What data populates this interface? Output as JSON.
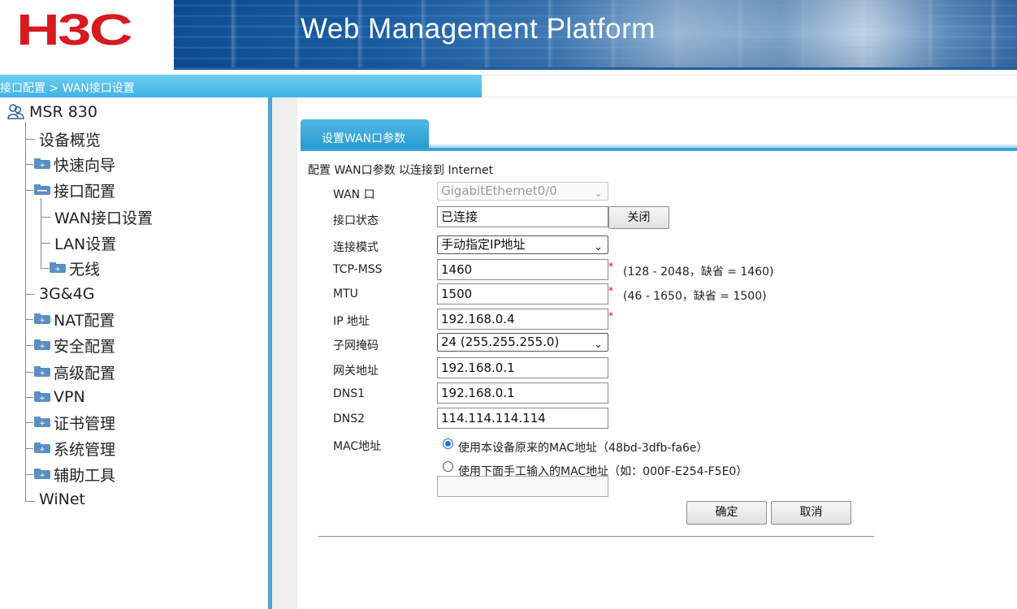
{
  "header": {
    "logo_text": "H3C",
    "platform_title": "Web Management Platform"
  },
  "breadcrumb": "接口配置 > WAN接口设置",
  "sidebar": {
    "root": "MSR 830",
    "items": [
      {
        "label": "设备概览"
      },
      {
        "label": "快速向导"
      },
      {
        "label": "接口配置"
      },
      {
        "label": "WAN接口设置"
      },
      {
        "label": "LAN设置"
      },
      {
        "label": "无线"
      },
      {
        "label": "3G&4G"
      },
      {
        "label": "NAT配置"
      },
      {
        "label": "安全配置"
      },
      {
        "label": "高级配置"
      },
      {
        "label": "VPN"
      },
      {
        "label": "证书管理"
      },
      {
        "label": "系统管理"
      },
      {
        "label": "辅助工具"
      },
      {
        "label": "WiNet"
      }
    ]
  },
  "main": {
    "tab_label": "设置WAN口参数",
    "intro": "配置 WAN口参数 以连接到 Internet",
    "fields": {
      "wan_port": {
        "label": "WAN 口",
        "value": "GigabitEthernet0/0"
      },
      "status": {
        "label": "接口状态",
        "value": "已连接",
        "button": "关闭"
      },
      "mode": {
        "label": "连接模式",
        "value": "手动指定IP地址"
      },
      "tcp_mss": {
        "label": "TCP-MSS",
        "value": "1460",
        "hint": "(128 - 2048，缺省 = 1460)"
      },
      "mtu": {
        "label": "MTU",
        "value": "1500",
        "hint": "(46 - 1650，缺省 = 1500)"
      },
      "ip": {
        "label": "IP 地址",
        "value": "192.168.0.4"
      },
      "mask": {
        "label": "子网掩码",
        "value": "24 (255.255.255.0)"
      },
      "gateway": {
        "label": "网关地址",
        "value": "192.168.0.1"
      },
      "dns1": {
        "label": "DNS1",
        "value": "192.168.0.1"
      },
      "dns2": {
        "label": "DNS2",
        "value": "114.114.114.114"
      },
      "mac": {
        "label": "MAC地址",
        "option_default": "使用本设备原来的MAC地址（48bd-3dfb-fa6e）",
        "option_manual": "使用下面手工输入的MAC地址（如：000F-E254-F5E0）",
        "manual_value": ""
      }
    },
    "required_mark": "*",
    "ok_label": "确定",
    "cancel_label": "取消"
  },
  "colors": {
    "logo_red": "#d71920",
    "breadcrumb_blue": "#3fb3e6",
    "tab_blue": "#2a9bd1",
    "radio_blue": "#1a73e8"
  }
}
